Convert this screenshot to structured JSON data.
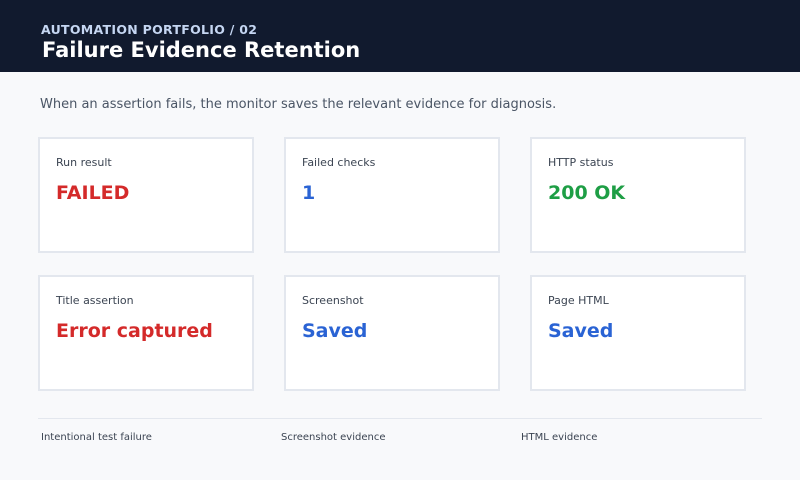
{
  "header": {
    "eyebrow": "AUTOMATION PORTFOLIO / 02",
    "title": "Failure Evidence Retention"
  },
  "description": "When an assertion fails, the monitor saves the relevant evidence for diagnosis.",
  "cards": [
    {
      "label": "Run result",
      "value": "FAILED",
      "color": "#d42a2a"
    },
    {
      "label": "Failed checks",
      "value": "1",
      "color": "#2a63d4"
    },
    {
      "label": "HTTP status",
      "value": "200 OK",
      "color": "#1e9e45"
    },
    {
      "label": "Title assertion",
      "value": "Error captured",
      "color": "#d42a2a"
    },
    {
      "label": "Screenshot",
      "value": "Saved",
      "color": "#2a63d4"
    },
    {
      "label": "Page HTML",
      "value": "Saved",
      "color": "#2a63d4"
    }
  ],
  "footer": [
    "Intentional test failure",
    "Screenshot evidence",
    "HTML evidence"
  ],
  "colors": {
    "header_bg": "#111a2e",
    "page_bg": "#f8f9fb",
    "error": "#d42a2a",
    "info": "#2a63d4",
    "success": "#1e9e45"
  }
}
